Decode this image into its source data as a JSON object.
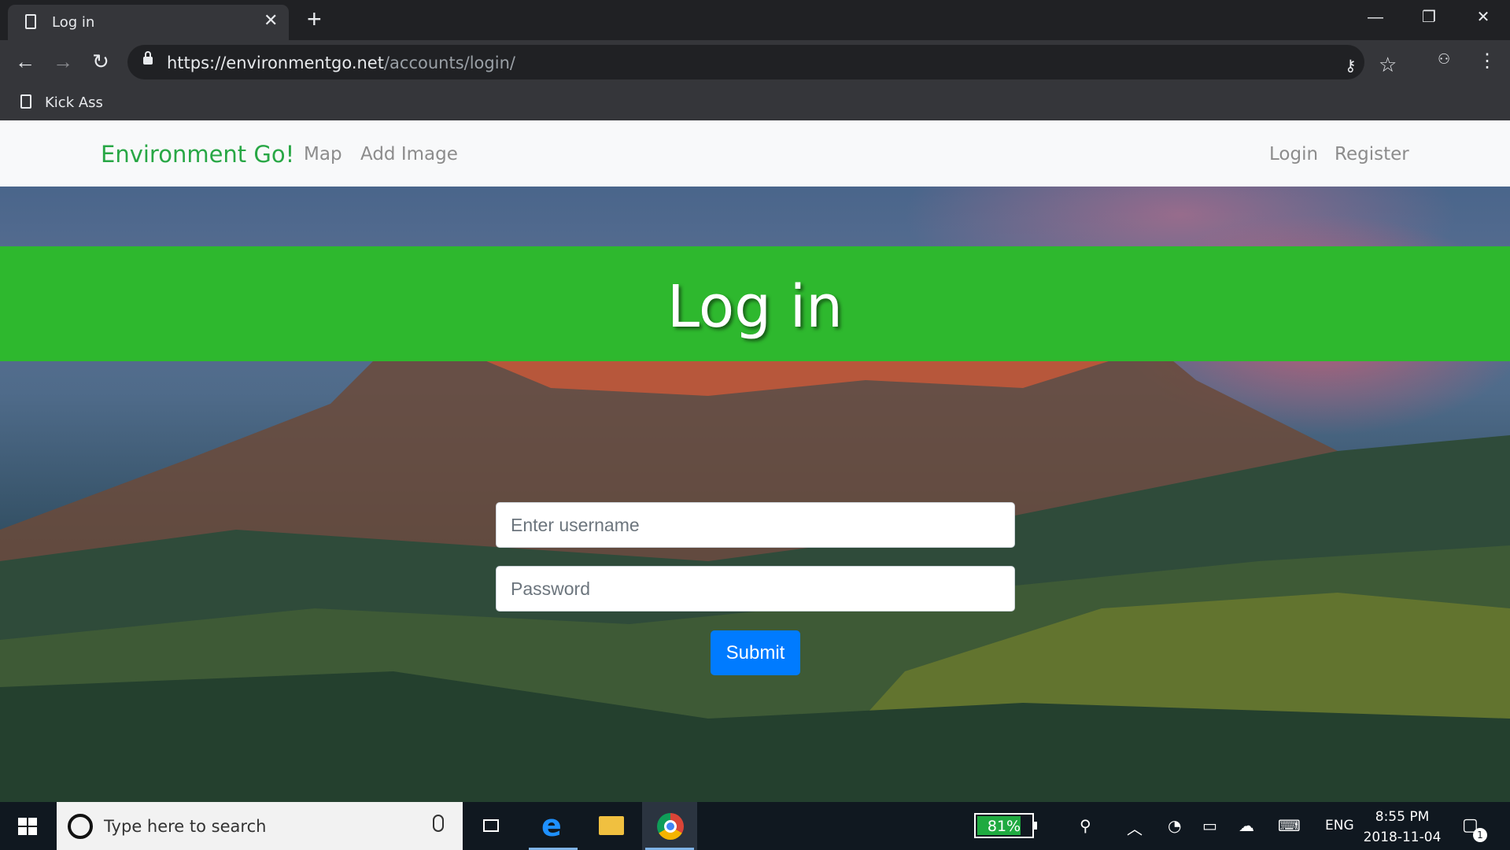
{
  "browser": {
    "tab_title": "Log in",
    "tab_close": "✕",
    "new_tab": "+",
    "url_host": "https://environmentgo.net",
    "url_path": "/accounts/login/",
    "bookmark_label": "Kick Ass",
    "window_controls": {
      "minimize": "—",
      "maximize": "❐",
      "close": "✕"
    }
  },
  "navbar": {
    "brand": "Environment Go!",
    "links": [
      "Map",
      "Add Image"
    ],
    "right_links": [
      "Login",
      "Register"
    ]
  },
  "login": {
    "title": "Log in",
    "username_placeholder": "Enter username",
    "password_placeholder": "Password",
    "submit_label": "Submit"
  },
  "taskbar": {
    "search_placeholder": "Type here to search",
    "battery_text": "81%",
    "battery_level": 0.81,
    "language": "ENG",
    "time": "8:55 PM",
    "date": "2018-11-04",
    "notification_count": "1"
  },
  "colors": {
    "brand_green": "#28a745",
    "banner_green": "#2eb82e",
    "submit_blue": "#007bff"
  }
}
